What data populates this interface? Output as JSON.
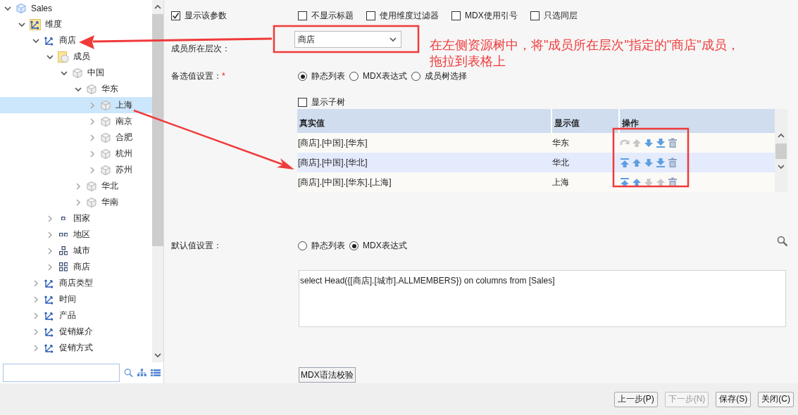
{
  "tree": [
    {
      "label": "Sales",
      "kind": "cube",
      "expanded": true,
      "selected": false,
      "children": [
        {
          "label": "维度",
          "kind": "dimensions",
          "expanded": true,
          "selected": false,
          "children": [
            {
              "label": "商店",
              "kind": "hierarchy",
              "expanded": true,
              "selected": false,
              "children": [
                {
                  "label": "成员",
                  "kind": "members",
                  "expanded": true,
                  "selected": false,
                  "children": [
                    {
                      "label": "中国",
                      "kind": "member",
                      "expanded": true,
                      "selected": false,
                      "children": [
                        {
                          "label": "华东",
                          "kind": "member",
                          "expanded": true,
                          "selected": false,
                          "children": [
                            {
                              "label": "上海",
                              "kind": "member",
                              "expanded": false,
                              "selected": true
                            },
                            {
                              "label": "南京",
                              "kind": "member",
                              "expanded": false,
                              "selected": false
                            },
                            {
                              "label": "合肥",
                              "kind": "member",
                              "expanded": false,
                              "selected": false
                            },
                            {
                              "label": "杭州",
                              "kind": "member",
                              "expanded": false,
                              "selected": false
                            },
                            {
                              "label": "苏州",
                              "kind": "member",
                              "expanded": false,
                              "selected": false
                            }
                          ]
                        },
                        {
                          "label": "华北",
                          "kind": "member",
                          "expanded": false,
                          "selected": false
                        },
                        {
                          "label": "华南",
                          "kind": "member",
                          "expanded": false,
                          "selected": false
                        }
                      ]
                    }
                  ]
                },
                {
                  "label": "国家",
                  "kind": "level1",
                  "expanded": false,
                  "selected": false
                },
                {
                  "label": "地区",
                  "kind": "level2",
                  "expanded": false,
                  "selected": false
                },
                {
                  "label": "城市",
                  "kind": "level3",
                  "expanded": false,
                  "selected": false
                },
                {
                  "label": "商店",
                  "kind": "level4",
                  "expanded": false,
                  "selected": false
                }
              ]
            },
            {
              "label": "商店类型",
              "kind": "hierarchy",
              "expanded": false,
              "selected": false
            },
            {
              "label": "时间",
              "kind": "hierarchy",
              "expanded": false,
              "selected": false
            },
            {
              "label": "产品",
              "kind": "hierarchy",
              "expanded": false,
              "selected": false
            },
            {
              "label": "促销媒介",
              "kind": "hierarchy",
              "expanded": false,
              "selected": false
            },
            {
              "label": "促销方式",
              "kind": "hierarchy",
              "expanded": false,
              "selected": false
            }
          ]
        }
      ]
    }
  ],
  "options": [
    {
      "label": "显示该参数",
      "checked": true
    },
    {
      "label": "不显示标题",
      "checked": false
    },
    {
      "label": "使用维度过滤器",
      "checked": false
    },
    {
      "label": "MDX使用引号",
      "checked": false
    },
    {
      "label": "只选同层",
      "checked": false
    }
  ],
  "level_field": {
    "label": "成员所在层次：",
    "value": "商店"
  },
  "candidates": {
    "label": "备选值设置：",
    "required_mark": "*",
    "modes": [
      {
        "label": "静态列表",
        "selected": true
      },
      {
        "label": "MDX表达式",
        "selected": false
      },
      {
        "label": "成员树选择",
        "selected": false
      }
    ],
    "show_subtree": {
      "label": "显示子树",
      "checked": false
    },
    "table": {
      "columns": [
        "真实值",
        "显示值",
        "操作"
      ],
      "rows": [
        {
          "real": "[商店].[中国].[华东]",
          "display": "华东",
          "selected": false,
          "actions": [
            {
              "kind": "redo",
              "disabled": true
            },
            {
              "kind": "up",
              "disabled": true
            },
            {
              "kind": "down",
              "disabled": false
            },
            {
              "kind": "bottom",
              "disabled": false
            },
            {
              "kind": "delete",
              "disabled": false
            }
          ]
        },
        {
          "real": "[商店].[中国].[华北]",
          "display": "华北",
          "selected": true,
          "actions": [
            {
              "kind": "top",
              "disabled": false
            },
            {
              "kind": "up",
              "disabled": false
            },
            {
              "kind": "down",
              "disabled": false
            },
            {
              "kind": "bottom",
              "disabled": false
            },
            {
              "kind": "delete",
              "disabled": false
            }
          ]
        },
        {
          "real": "[商店].[中国].[华东].[上海]",
          "display": "上海",
          "selected": false,
          "actions": [
            {
              "kind": "top",
              "disabled": false
            },
            {
              "kind": "up",
              "disabled": false
            },
            {
              "kind": "down",
              "disabled": true
            },
            {
              "kind": "up",
              "disabled": true
            },
            {
              "kind": "delete",
              "disabled": false
            }
          ]
        }
      ]
    }
  },
  "default_value": {
    "label": "默认值设置：",
    "modes": [
      {
        "label": "静态列表",
        "selected": false
      },
      {
        "label": "MDX表达式",
        "selected": true
      }
    ],
    "expression": "select Head({[商店].[城市].ALLMEMBERS}) on columns from [Sales]",
    "validate_button": "MDX语法校验"
  },
  "buttons": [
    {
      "label": "上一步(P)",
      "disabled": false
    },
    {
      "label": "下一步(N)",
      "disabled": true
    },
    {
      "label": "保存(S)",
      "disabled": false
    },
    {
      "label": "关闭(C)",
      "disabled": false
    }
  ],
  "annotation": {
    "lines": [
      "在左侧资源树中，将\"成员所在层次\"指定的\"商店\"成员，",
      "拖拉到表格上"
    ]
  }
}
